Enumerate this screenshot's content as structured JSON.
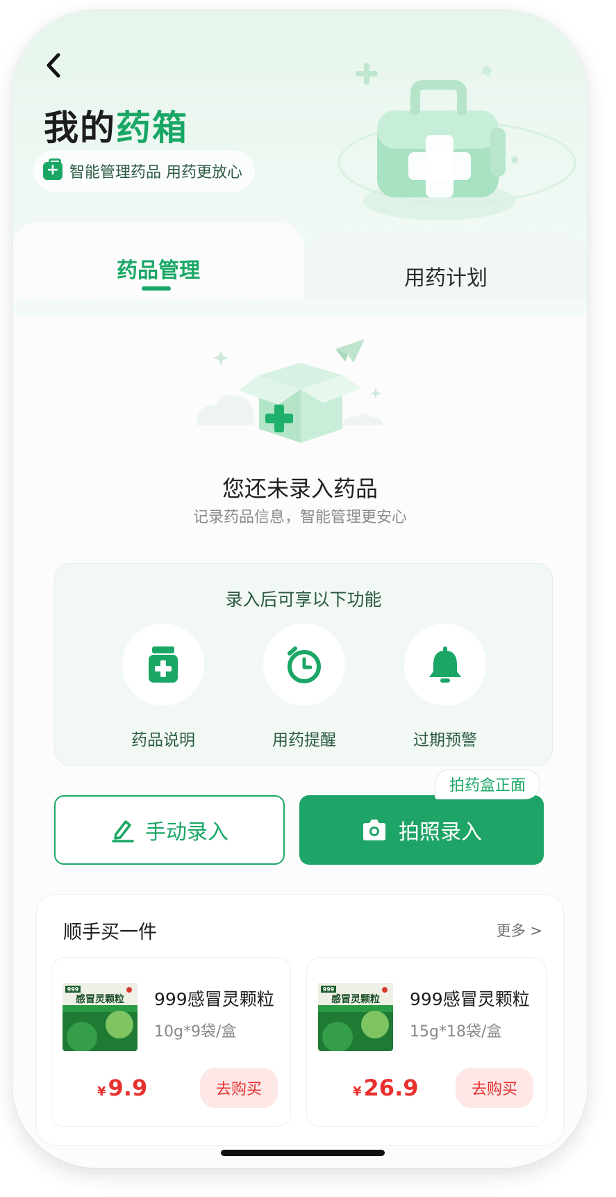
{
  "header": {
    "title_prefix": "我的",
    "title_accent": "药箱",
    "tagline": "智能管理药品 用药更放心"
  },
  "tabs": [
    {
      "label": "药品管理",
      "active": true
    },
    {
      "label": "用药计划",
      "active": false
    }
  ],
  "empty_state": {
    "title": "您还未录入药品",
    "subtitle": "记录药品信息，智能管理更安心"
  },
  "features": {
    "title": "录入后可享以下功能",
    "items": [
      {
        "label": "药品说明",
        "icon": "medicine-bottle-icon"
      },
      {
        "label": "用药提醒",
        "icon": "alarm-clock-icon"
      },
      {
        "label": "过期预警",
        "icon": "bell-icon"
      }
    ]
  },
  "actions": {
    "manual_label": "手动录入",
    "photo_label": "拍照录入",
    "photo_tip": "拍药盒正面"
  },
  "shop": {
    "title": "顺手买一件",
    "more": "更多 >",
    "products": [
      {
        "name": "999感冒灵颗粒",
        "spec": "10g*9袋/盒",
        "currency": "¥",
        "price": "9.9",
        "buy_label": "去购买",
        "box_label": "感冒灵颗粒",
        "box_brand": "999"
      },
      {
        "name": "999感冒灵颗粒",
        "spec": "15g*18袋/盒",
        "currency": "¥",
        "price": "26.9",
        "buy_label": "去购买",
        "box_label": "感冒灵颗粒",
        "box_brand": "999"
      }
    ]
  },
  "colors": {
    "brand_green": "#1aa765",
    "price_red": "#e8312f",
    "hero_bg": "#e6f5ec"
  }
}
